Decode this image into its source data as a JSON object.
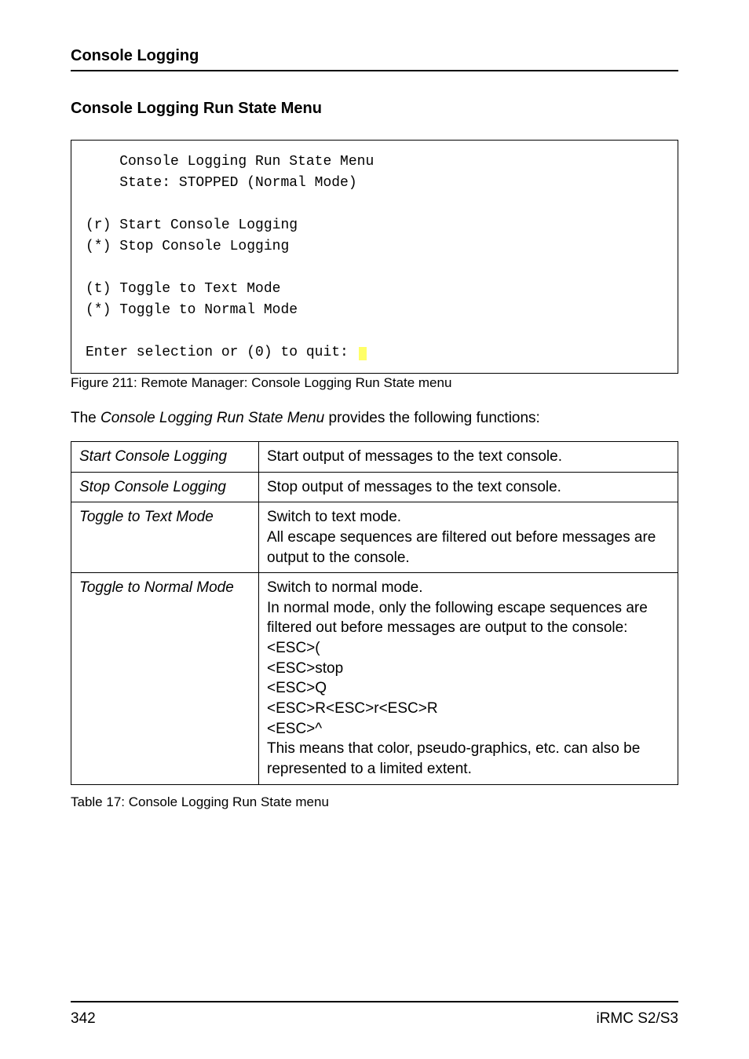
{
  "header": {
    "title": "Console Logging"
  },
  "subsection": {
    "title": "Console Logging Run State Menu"
  },
  "console": {
    "lines": [
      "    Console Logging Run State Menu",
      "    State: STOPPED (Normal Mode)",
      "",
      "(r) Start Console Logging",
      "(*) Stop Console Logging",
      "",
      "(t) Toggle to Text Mode",
      "(*) Toggle to Normal Mode",
      "",
      "Enter selection or (0) to quit: "
    ]
  },
  "figure_caption": "Figure 211: Remote Manager: Console Logging Run State menu",
  "intro": {
    "prefix": "The ",
    "em": "Console Logging Run State Menu",
    "suffix": " provides the following functions:"
  },
  "table": {
    "rows": [
      {
        "name": "Start Console Logging",
        "desc": [
          "Start output of messages to the text console."
        ]
      },
      {
        "name": "Stop Console Logging",
        "desc": [
          "Stop output of messages to the text console."
        ]
      },
      {
        "name": "Toggle to Text Mode",
        "desc": [
          "Switch to text mode.",
          "All escape sequences are filtered out before messages are output to the console."
        ]
      },
      {
        "name": "Toggle to Normal Mode",
        "desc": [
          "Switch to normal mode.",
          "In normal mode, only the following escape sequences are filtered out before messages are output to the console:",
          "<ESC>(",
          "<ESC>stop",
          "<ESC>Q",
          "<ESC>R<ESC>r<ESC>R",
          "<ESC>^",
          "This means that color, pseudo-graphics, etc. can also be represented to a limited extent."
        ]
      }
    ]
  },
  "table_caption": "Table 17: Console Logging Run State menu",
  "footer": {
    "page": "342",
    "doc": "iRMC S2/S3"
  }
}
